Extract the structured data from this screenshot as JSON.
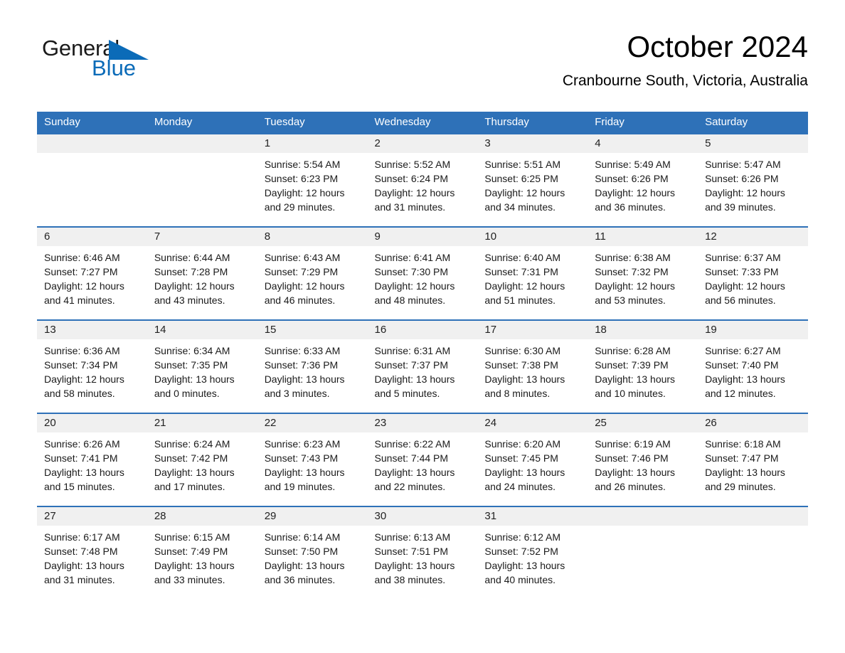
{
  "brand": {
    "name_part1": "General",
    "name_part2": "Blue",
    "triangle_color": "#0b6bb8"
  },
  "header": {
    "month_title": "October 2024",
    "location": "Cranbourne South, Victoria, Australia",
    "header_bg": "#2e71b8",
    "daynum_bg": "#f0f0f0"
  },
  "weekdays": [
    "Sunday",
    "Monday",
    "Tuesday",
    "Wednesday",
    "Thursday",
    "Friday",
    "Saturday"
  ],
  "weeks": [
    [
      {
        "day": "",
        "l1": "",
        "l2": "",
        "l3": "",
        "l4": ""
      },
      {
        "day": "",
        "l1": "",
        "l2": "",
        "l3": "",
        "l4": ""
      },
      {
        "day": "1",
        "l1": "Sunrise: 5:54 AM",
        "l2": "Sunset: 6:23 PM",
        "l3": "Daylight: 12 hours",
        "l4": "and 29 minutes."
      },
      {
        "day": "2",
        "l1": "Sunrise: 5:52 AM",
        "l2": "Sunset: 6:24 PM",
        "l3": "Daylight: 12 hours",
        "l4": "and 31 minutes."
      },
      {
        "day": "3",
        "l1": "Sunrise: 5:51 AM",
        "l2": "Sunset: 6:25 PM",
        "l3": "Daylight: 12 hours",
        "l4": "and 34 minutes."
      },
      {
        "day": "4",
        "l1": "Sunrise: 5:49 AM",
        "l2": "Sunset: 6:26 PM",
        "l3": "Daylight: 12 hours",
        "l4": "and 36 minutes."
      },
      {
        "day": "5",
        "l1": "Sunrise: 5:47 AM",
        "l2": "Sunset: 6:26 PM",
        "l3": "Daylight: 12 hours",
        "l4": "and 39 minutes."
      }
    ],
    [
      {
        "day": "6",
        "l1": "Sunrise: 6:46 AM",
        "l2": "Sunset: 7:27 PM",
        "l3": "Daylight: 12 hours",
        "l4": "and 41 minutes."
      },
      {
        "day": "7",
        "l1": "Sunrise: 6:44 AM",
        "l2": "Sunset: 7:28 PM",
        "l3": "Daylight: 12 hours",
        "l4": "and 43 minutes."
      },
      {
        "day": "8",
        "l1": "Sunrise: 6:43 AM",
        "l2": "Sunset: 7:29 PM",
        "l3": "Daylight: 12 hours",
        "l4": "and 46 minutes."
      },
      {
        "day": "9",
        "l1": "Sunrise: 6:41 AM",
        "l2": "Sunset: 7:30 PM",
        "l3": "Daylight: 12 hours",
        "l4": "and 48 minutes."
      },
      {
        "day": "10",
        "l1": "Sunrise: 6:40 AM",
        "l2": "Sunset: 7:31 PM",
        "l3": "Daylight: 12 hours",
        "l4": "and 51 minutes."
      },
      {
        "day": "11",
        "l1": "Sunrise: 6:38 AM",
        "l2": "Sunset: 7:32 PM",
        "l3": "Daylight: 12 hours",
        "l4": "and 53 minutes."
      },
      {
        "day": "12",
        "l1": "Sunrise: 6:37 AM",
        "l2": "Sunset: 7:33 PM",
        "l3": "Daylight: 12 hours",
        "l4": "and 56 minutes."
      }
    ],
    [
      {
        "day": "13",
        "l1": "Sunrise: 6:36 AM",
        "l2": "Sunset: 7:34 PM",
        "l3": "Daylight: 12 hours",
        "l4": "and 58 minutes."
      },
      {
        "day": "14",
        "l1": "Sunrise: 6:34 AM",
        "l2": "Sunset: 7:35 PM",
        "l3": "Daylight: 13 hours",
        "l4": "and 0 minutes."
      },
      {
        "day": "15",
        "l1": "Sunrise: 6:33 AM",
        "l2": "Sunset: 7:36 PM",
        "l3": "Daylight: 13 hours",
        "l4": "and 3 minutes."
      },
      {
        "day": "16",
        "l1": "Sunrise: 6:31 AM",
        "l2": "Sunset: 7:37 PM",
        "l3": "Daylight: 13 hours",
        "l4": "and 5 minutes."
      },
      {
        "day": "17",
        "l1": "Sunrise: 6:30 AM",
        "l2": "Sunset: 7:38 PM",
        "l3": "Daylight: 13 hours",
        "l4": "and 8 minutes."
      },
      {
        "day": "18",
        "l1": "Sunrise: 6:28 AM",
        "l2": "Sunset: 7:39 PM",
        "l3": "Daylight: 13 hours",
        "l4": "and 10 minutes."
      },
      {
        "day": "19",
        "l1": "Sunrise: 6:27 AM",
        "l2": "Sunset: 7:40 PM",
        "l3": "Daylight: 13 hours",
        "l4": "and 12 minutes."
      }
    ],
    [
      {
        "day": "20",
        "l1": "Sunrise: 6:26 AM",
        "l2": "Sunset: 7:41 PM",
        "l3": "Daylight: 13 hours",
        "l4": "and 15 minutes."
      },
      {
        "day": "21",
        "l1": "Sunrise: 6:24 AM",
        "l2": "Sunset: 7:42 PM",
        "l3": "Daylight: 13 hours",
        "l4": "and 17 minutes."
      },
      {
        "day": "22",
        "l1": "Sunrise: 6:23 AM",
        "l2": "Sunset: 7:43 PM",
        "l3": "Daylight: 13 hours",
        "l4": "and 19 minutes."
      },
      {
        "day": "23",
        "l1": "Sunrise: 6:22 AM",
        "l2": "Sunset: 7:44 PM",
        "l3": "Daylight: 13 hours",
        "l4": "and 22 minutes."
      },
      {
        "day": "24",
        "l1": "Sunrise: 6:20 AM",
        "l2": "Sunset: 7:45 PM",
        "l3": "Daylight: 13 hours",
        "l4": "and 24 minutes."
      },
      {
        "day": "25",
        "l1": "Sunrise: 6:19 AM",
        "l2": "Sunset: 7:46 PM",
        "l3": "Daylight: 13 hours",
        "l4": "and 26 minutes."
      },
      {
        "day": "26",
        "l1": "Sunrise: 6:18 AM",
        "l2": "Sunset: 7:47 PM",
        "l3": "Daylight: 13 hours",
        "l4": "and 29 minutes."
      }
    ],
    [
      {
        "day": "27",
        "l1": "Sunrise: 6:17 AM",
        "l2": "Sunset: 7:48 PM",
        "l3": "Daylight: 13 hours",
        "l4": "and 31 minutes."
      },
      {
        "day": "28",
        "l1": "Sunrise: 6:15 AM",
        "l2": "Sunset: 7:49 PM",
        "l3": "Daylight: 13 hours",
        "l4": "and 33 minutes."
      },
      {
        "day": "29",
        "l1": "Sunrise: 6:14 AM",
        "l2": "Sunset: 7:50 PM",
        "l3": "Daylight: 13 hours",
        "l4": "and 36 minutes."
      },
      {
        "day": "30",
        "l1": "Sunrise: 6:13 AM",
        "l2": "Sunset: 7:51 PM",
        "l3": "Daylight: 13 hours",
        "l4": "and 38 minutes."
      },
      {
        "day": "31",
        "l1": "Sunrise: 6:12 AM",
        "l2": "Sunset: 7:52 PM",
        "l3": "Daylight: 13 hours",
        "l4": "and 40 minutes."
      },
      {
        "day": "",
        "l1": "",
        "l2": "",
        "l3": "",
        "l4": ""
      },
      {
        "day": "",
        "l1": "",
        "l2": "",
        "l3": "",
        "l4": ""
      }
    ]
  ]
}
